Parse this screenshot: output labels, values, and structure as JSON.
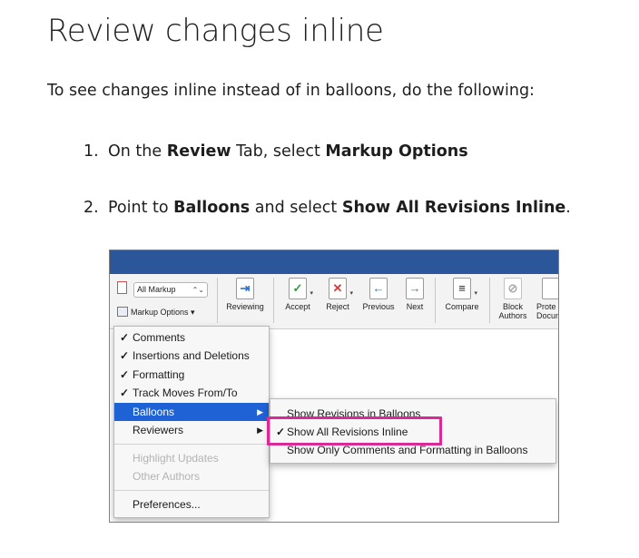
{
  "heading": "Review changes inline",
  "intro": "To see changes inline instead of in balloons, do the following:",
  "steps": [
    {
      "number": "1.",
      "pre": "On the ",
      "bold1": "Review",
      "mid": " Tab, select ",
      "bold2": "Markup Options",
      "post": ""
    },
    {
      "number": "2.",
      "pre": "Point to ",
      "bold1": "Balloons",
      "mid": " and select ",
      "bold2": "Show All Revisions Inline",
      "post": "."
    }
  ],
  "screenshot": {
    "ribbon": {
      "markup_select_value": "All Markup",
      "markup_options_label": "Markup Options",
      "markup_options_arrow": "▾",
      "select_arrow": "⌃⌄",
      "reviewing_label": "Reviewing",
      "accept_label": "Accept",
      "reject_label": "Reject",
      "previous_label": "Previous",
      "next_label": "Next",
      "compare_label": "Compare",
      "block_authors_label_1": "Block",
      "block_authors_label_2": "Authors",
      "protect_label_1": "Prote",
      "protect_label_2": "Docum"
    },
    "main_menu": {
      "items": [
        {
          "label": "Comments",
          "checked": true
        },
        {
          "label": "Insertions and Deletions",
          "checked": true
        },
        {
          "label": "Formatting",
          "checked": true
        },
        {
          "label": "Track Moves From/To",
          "checked": true
        },
        {
          "label": "Balloons",
          "submenu": true,
          "highlighted": true
        },
        {
          "label": "Reviewers",
          "submenu": true
        },
        {
          "label": "Highlight Updates",
          "disabled": true
        },
        {
          "label": "Other Authors",
          "disabled": true
        },
        {
          "label": "Preferences..."
        }
      ],
      "check_glyph": "✓",
      "submenu_glyph": "▶"
    },
    "sub_menu": {
      "items": [
        {
          "label": "Show Revisions in Balloons"
        },
        {
          "label": "Show All Revisions Inline",
          "checked": true
        },
        {
          "label": "Show Only Comments and Formatting in Balloons"
        }
      ]
    },
    "colors": {
      "titlebar": "#2b579a",
      "menu_highlight": "#1f62d6",
      "callout_box": "#d92a98"
    }
  }
}
